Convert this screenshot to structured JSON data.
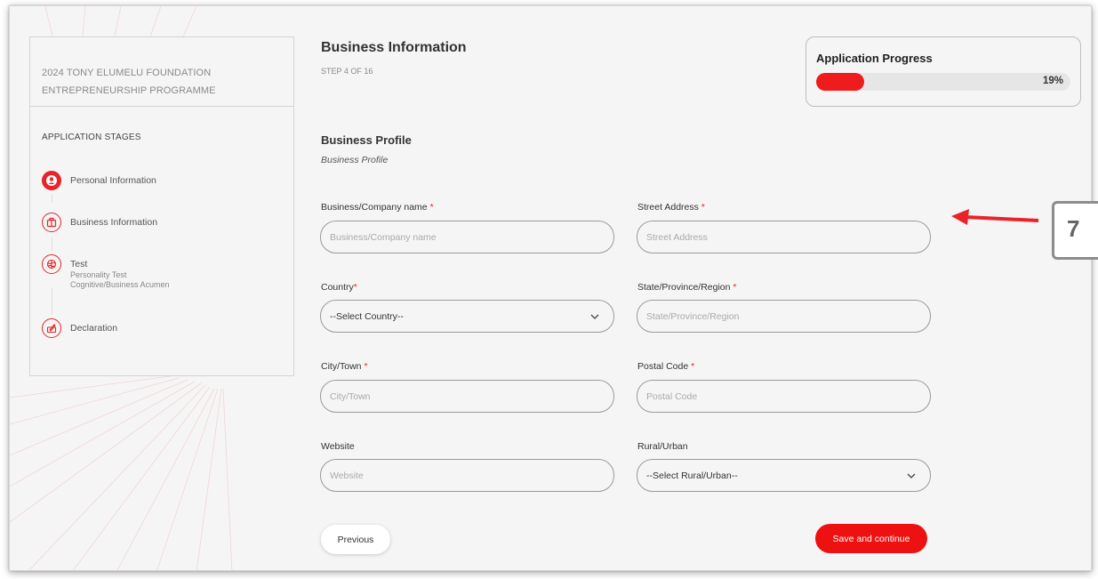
{
  "sidebar": {
    "program_title_line1": "2024 TONY ELUMELU FOUNDATION",
    "program_title_line2": "ENTREPRENEURSHIP PROGRAMME",
    "stages_title": "APPLICATION STAGES",
    "stages": [
      {
        "label": "Personal Information",
        "icon": "user-icon",
        "active": true
      },
      {
        "label": "Business Information",
        "icon": "briefcase-icon",
        "active": false
      },
      {
        "label": "Test",
        "sub1": "Personality Test",
        "sub2": "Cognitive/Business Acumen",
        "icon": "brain-icon",
        "active": false
      },
      {
        "label": "Declaration",
        "icon": "signature-icon",
        "active": false
      }
    ]
  },
  "header": {
    "title": "Business Information",
    "step": "STEP 4 OF 16"
  },
  "progress": {
    "title": "Application Progress",
    "percent_label": "19%",
    "fraction": 0.19,
    "color": "#ee1c1c"
  },
  "section": {
    "title": "Business Profile",
    "subtitle": "Business Profile"
  },
  "form": {
    "company_name": {
      "label": "Business/Company name",
      "placeholder": "Business/Company name",
      "value": ""
    },
    "street": {
      "label": "Street Address",
      "placeholder": "Street Address",
      "value": ""
    },
    "country": {
      "label": "Country",
      "selected": "--Select Country--"
    },
    "state": {
      "label": "State/Province/Region",
      "placeholder": "State/Province/Region",
      "value": ""
    },
    "city": {
      "label": "City/Town",
      "placeholder": "City/Town",
      "value": ""
    },
    "postal": {
      "label": "Postal Code",
      "placeholder": "Postal Code",
      "value": ""
    },
    "website": {
      "label": "Website",
      "placeholder": "Website",
      "value": ""
    },
    "rural_urban": {
      "label": "Rural/Urban",
      "selected": "--Select Rural/Urban--"
    },
    "required_mark": "*"
  },
  "actions": {
    "previous": "Previous",
    "save": "Save and continue"
  },
  "annotation": {
    "number": "7",
    "arrow_color": "#e8242a"
  }
}
